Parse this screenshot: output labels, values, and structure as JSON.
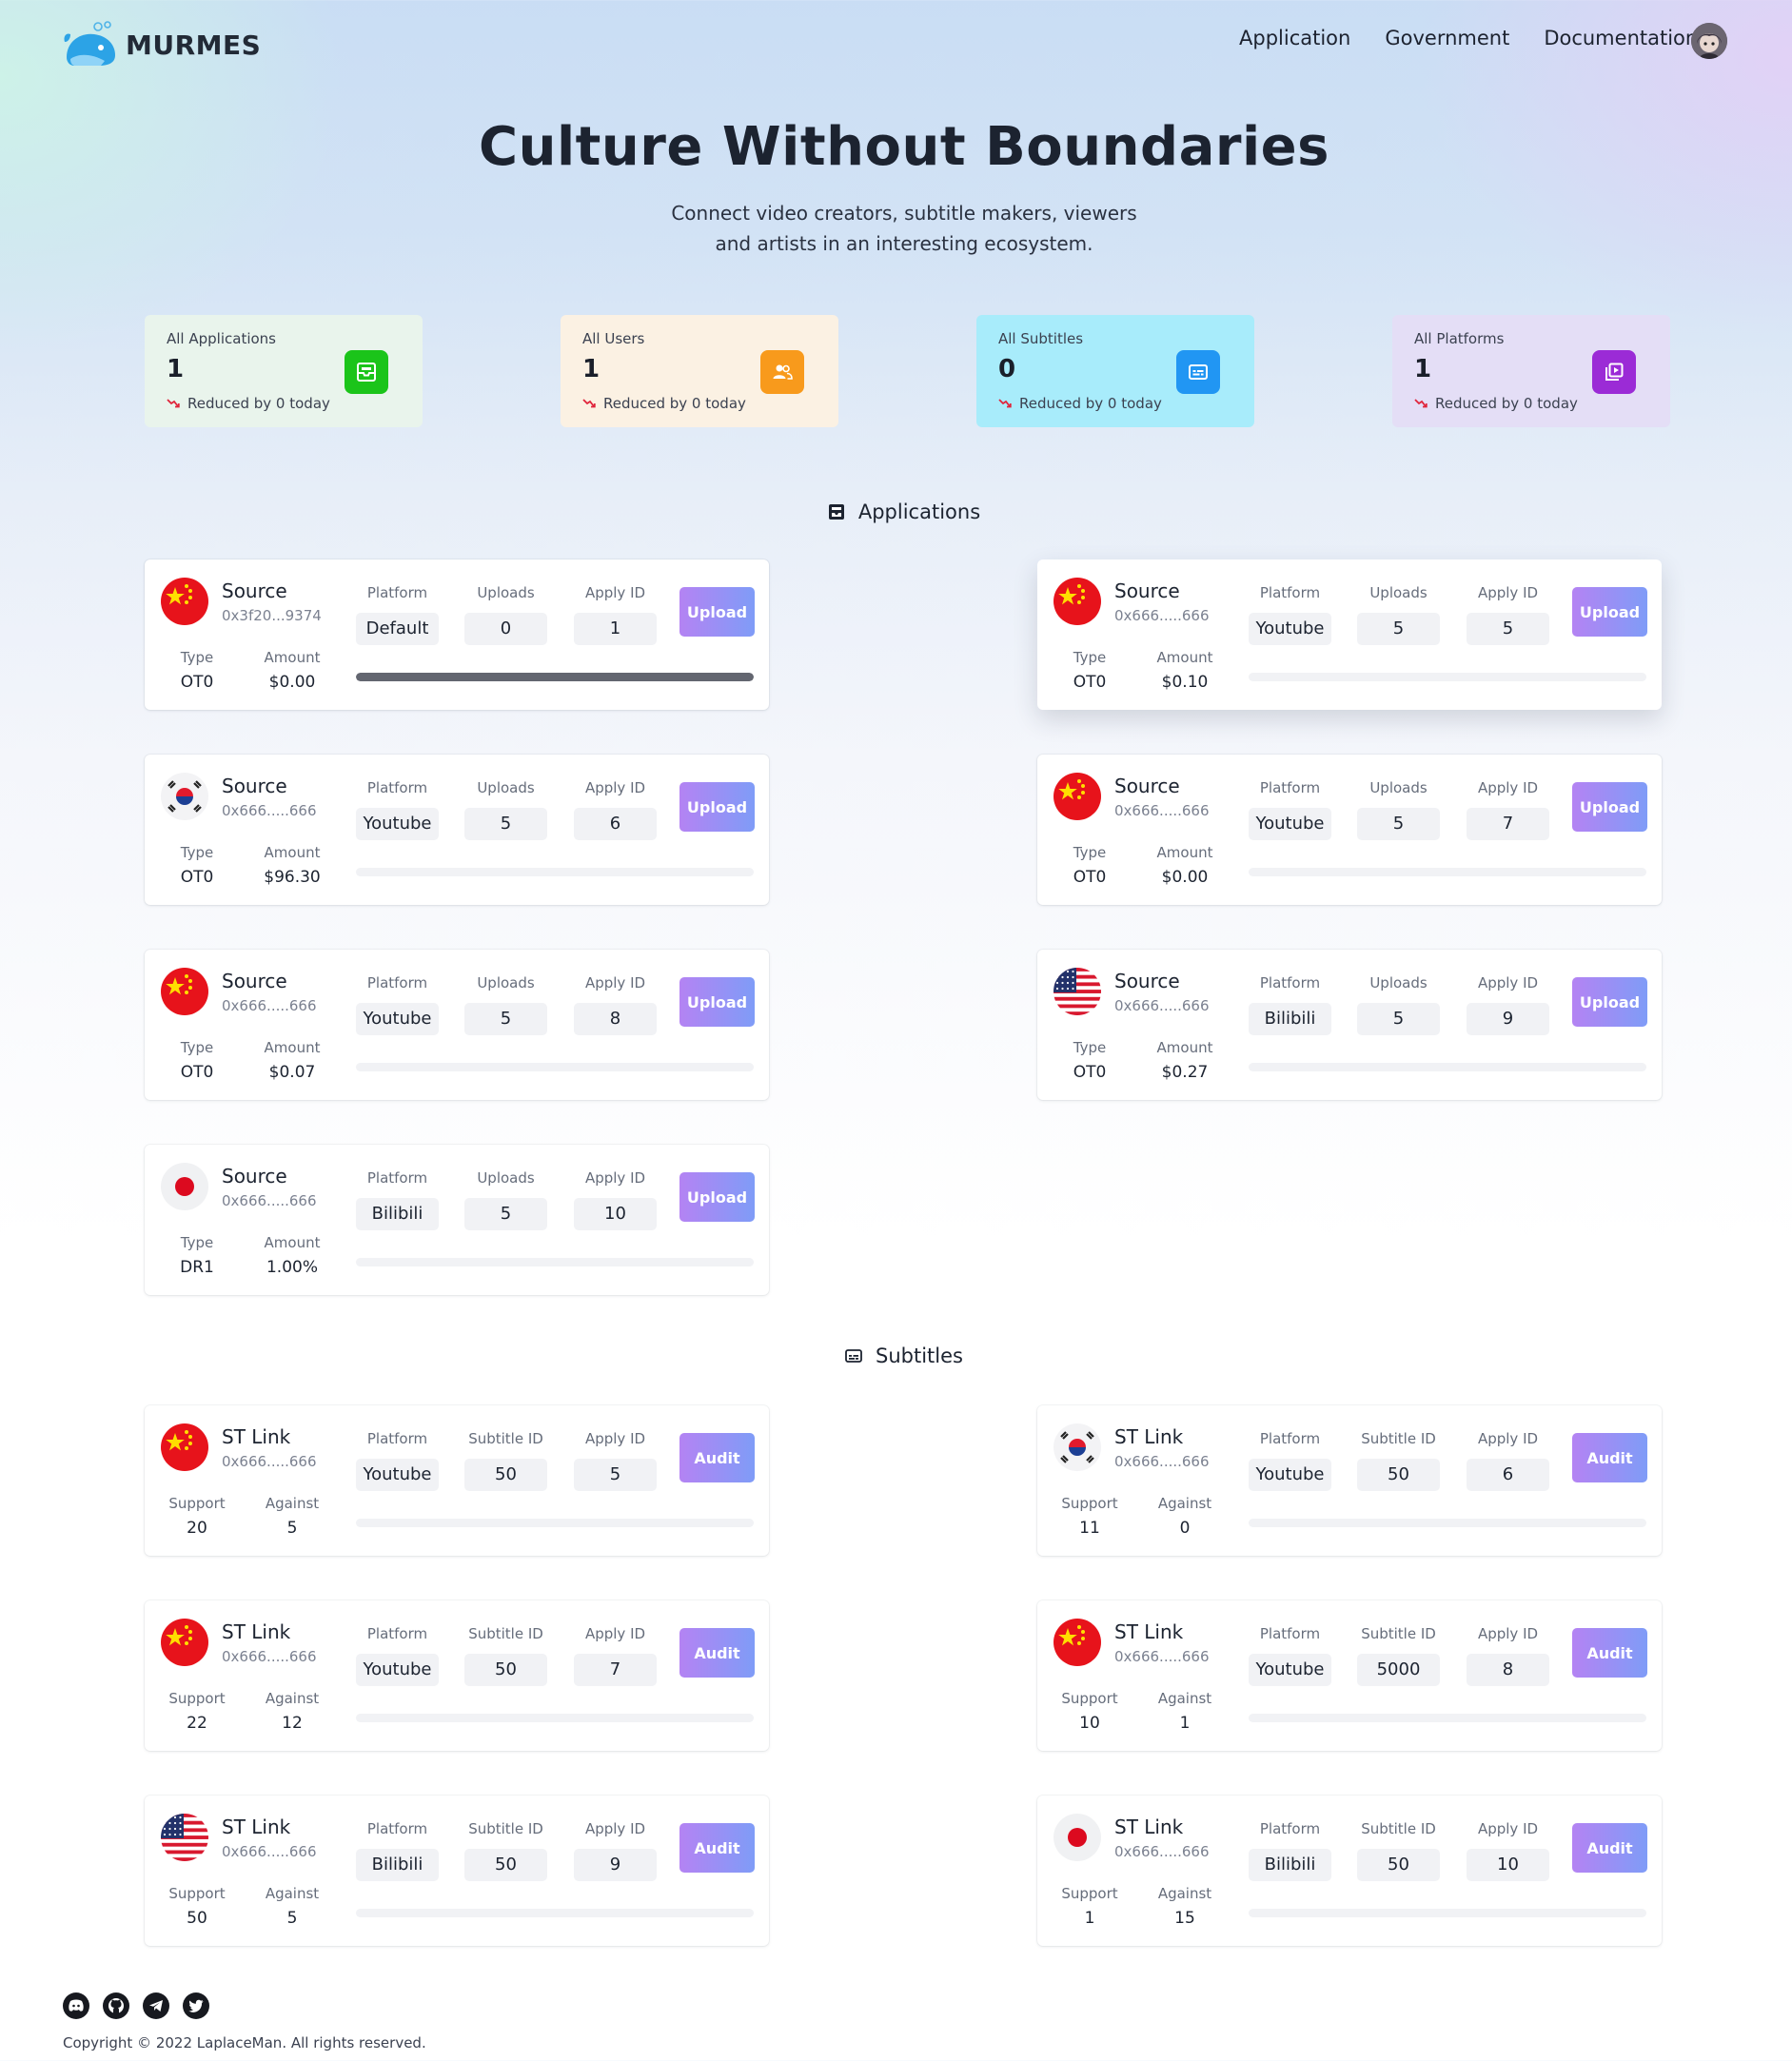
{
  "brand": {
    "name": "MURMES"
  },
  "nav": {
    "items": [
      "Application",
      "Government",
      "Documentation"
    ]
  },
  "hero": {
    "title": "Culture Without Boundaries",
    "subtitle": "Connect video creators, subtitle makers, viewers and artists in an interesting ecosystem."
  },
  "stats": [
    {
      "label": "All Applications",
      "value": "1",
      "trend": "Reduced by 0 today",
      "icon": "inbox-icon",
      "bg": "#e9f4ec",
      "icon_bg": "#1bc41a"
    },
    {
      "label": "All Users",
      "value": "1",
      "trend": "Reduced by 0 today",
      "icon": "users-icon",
      "bg": "#fbf1e3",
      "icon_bg": "#f89a1c"
    },
    {
      "label": "All Subtitles",
      "value": "0",
      "trend": "Reduced by 0 today",
      "icon": "subtitles-icon",
      "bg": "#a8ecfb",
      "icon_bg": "#2196f3"
    },
    {
      "label": "All Platforms",
      "value": "1",
      "trend": "Reduced by 0 today",
      "icon": "video-library-icon",
      "bg": "#e4def6",
      "icon_bg": "#9b2bd6"
    }
  ],
  "applications_section": {
    "title": "Applications"
  },
  "subtitles_section": {
    "title": "Subtitles"
  },
  "app_headers": {
    "platform": "Platform",
    "uploads": "Uploads",
    "apply_id": "Apply ID",
    "type": "Type",
    "amount": "Amount",
    "action": "Upload"
  },
  "sub_headers": {
    "platform": "Platform",
    "subtitle_id": "Subtitle ID",
    "apply_id": "Apply ID",
    "support": "Support",
    "against": "Against",
    "action": "Audit"
  },
  "applications": [
    {
      "title": "Source",
      "addr": "0x3f20...9374",
      "flag": "cn",
      "platform": "Default",
      "uploads": "0",
      "apply_id": "1",
      "type": "OT0",
      "amount": "$0.00",
      "progress": 1.0
    },
    {
      "title": "Source",
      "addr": "0x666.....666",
      "flag": "cn",
      "platform": "Youtube",
      "uploads": "5",
      "apply_id": "5",
      "type": "OT0",
      "amount": "$0.10",
      "progress": 0
    },
    {
      "title": "Source",
      "addr": "0x666.....666",
      "flag": "kr",
      "platform": "Youtube",
      "uploads": "5",
      "apply_id": "6",
      "type": "OT0",
      "amount": "$96.30",
      "progress": 0
    },
    {
      "title": "Source",
      "addr": "0x666.....666",
      "flag": "cn",
      "platform": "Youtube",
      "uploads": "5",
      "apply_id": "7",
      "type": "OT0",
      "amount": "$0.00",
      "progress": 0
    },
    {
      "title": "Source",
      "addr": "0x666.....666",
      "flag": "cn",
      "platform": "Youtube",
      "uploads": "5",
      "apply_id": "8",
      "type": "OT0",
      "amount": "$0.07",
      "progress": 0
    },
    {
      "title": "Source",
      "addr": "0x666.....666",
      "flag": "us",
      "platform": "Bilibili",
      "uploads": "5",
      "apply_id": "9",
      "type": "OT0",
      "amount": "$0.27",
      "progress": 0
    },
    {
      "title": "Source",
      "addr": "0x666.....666",
      "flag": "jp",
      "platform": "Bilibili",
      "uploads": "5",
      "apply_id": "10",
      "type": "DR1",
      "amount": "1.00%",
      "progress": 0
    }
  ],
  "subtitles": [
    {
      "title": "ST Link",
      "addr": "0x666.....666",
      "flag": "cn",
      "platform": "Youtube",
      "subtitle_id": "50",
      "apply_id": "5",
      "support": "20",
      "against": "5",
      "progress": 0
    },
    {
      "title": "ST Link",
      "addr": "0x666.....666",
      "flag": "kr",
      "platform": "Youtube",
      "subtitle_id": "50",
      "apply_id": "6",
      "support": "11",
      "against": "0",
      "progress": 0
    },
    {
      "title": "ST Link",
      "addr": "0x666.....666",
      "flag": "cn",
      "platform": "Youtube",
      "subtitle_id": "50",
      "apply_id": "7",
      "support": "22",
      "against": "12",
      "progress": 0
    },
    {
      "title": "ST Link",
      "addr": "0x666.....666",
      "flag": "cn",
      "platform": "Youtube",
      "subtitle_id": "5000",
      "apply_id": "8",
      "support": "10",
      "against": "1",
      "progress": 0
    },
    {
      "title": "ST Link",
      "addr": "0x666.....666",
      "flag": "us",
      "platform": "Bilibili",
      "subtitle_id": "50",
      "apply_id": "9",
      "support": "50",
      "against": "5",
      "progress": 0
    },
    {
      "title": "ST Link",
      "addr": "0x666.....666",
      "flag": "jp",
      "platform": "Bilibili",
      "subtitle_id": "50",
      "apply_id": "10",
      "support": "1",
      "against": "15",
      "progress": 0
    }
  ],
  "social": [
    "discord-icon",
    "github-icon",
    "telegram-icon",
    "twitter-icon"
  ],
  "footer": {
    "copyright": "Copyright © 2022 LaplaceMan. All rights reserved."
  }
}
